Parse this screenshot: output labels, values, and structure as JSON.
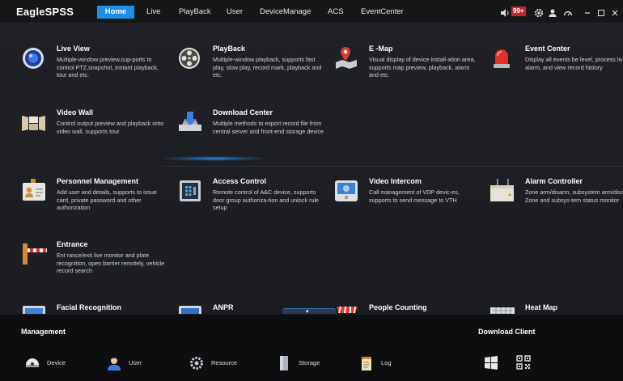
{
  "app": {
    "logo": "EagleSPSS"
  },
  "nav": [
    "Home",
    "Live",
    "PlayBack",
    "User",
    "DeviceManage",
    "ACS",
    "EventCenter"
  ],
  "header": {
    "alarm_badge": "99+"
  },
  "tiles": [
    {
      "title": "Live View",
      "desc": "Multiple-window preview,sup-ports to control PTZ,snapshot, instant playback, tour and etc."
    },
    {
      "title": "PlayBack",
      "desc": "Multiple-window playback, supports fast play, slow play, record mark, playback and etc."
    },
    {
      "title": "E -Map",
      "desc": "Visual display of device install-ation area, supports map preview, playback, alarm and etc."
    },
    {
      "title": "Event Center",
      "desc": "Display all events be level, process live alarm, and view record history"
    },
    {
      "title": "Video Wall",
      "desc": "Control output preview and playback onto video wall, supports tour"
    },
    {
      "title": "Download Center",
      "desc": "Multiple methods to export record file from central server and front-end storage device"
    },
    {
      "title": "Personnel Management",
      "desc": "Add user and details, supports to issue card, private password and other authorization"
    },
    {
      "title": "Access Control",
      "desc": "Remote control of A&C device, supports door group authoriza-tion and unlock rule setup"
    },
    {
      "title": "Video Intercom",
      "desc": "Call management of VDP devic-es, supports to send message to VTH"
    },
    {
      "title": "Alarm Controller",
      "desc": "Zone arm/disarm, subsystem arm/disarm, Zone and subsys-tem status monitor"
    },
    {
      "title": "Entrance",
      "desc": "Ent rance/exit live monitor and plate recognition, open barrier remotely, vehicle record search"
    },
    {
      "title": "Facial Recognition",
      "desc": ""
    },
    {
      "title": "ANPR",
      "desc": ""
    },
    {
      "title": "People Counting",
      "desc": ""
    },
    {
      "title": "Heat Map",
      "desc": ""
    }
  ],
  "management": {
    "title": "Management",
    "items": [
      "Device",
      "User",
      "Resource",
      "Storage",
      "Log"
    ]
  },
  "download_client": {
    "title": "Download Client"
  },
  "colors": {
    "accent": "#1e8fe8",
    "badge": "#c62828"
  }
}
